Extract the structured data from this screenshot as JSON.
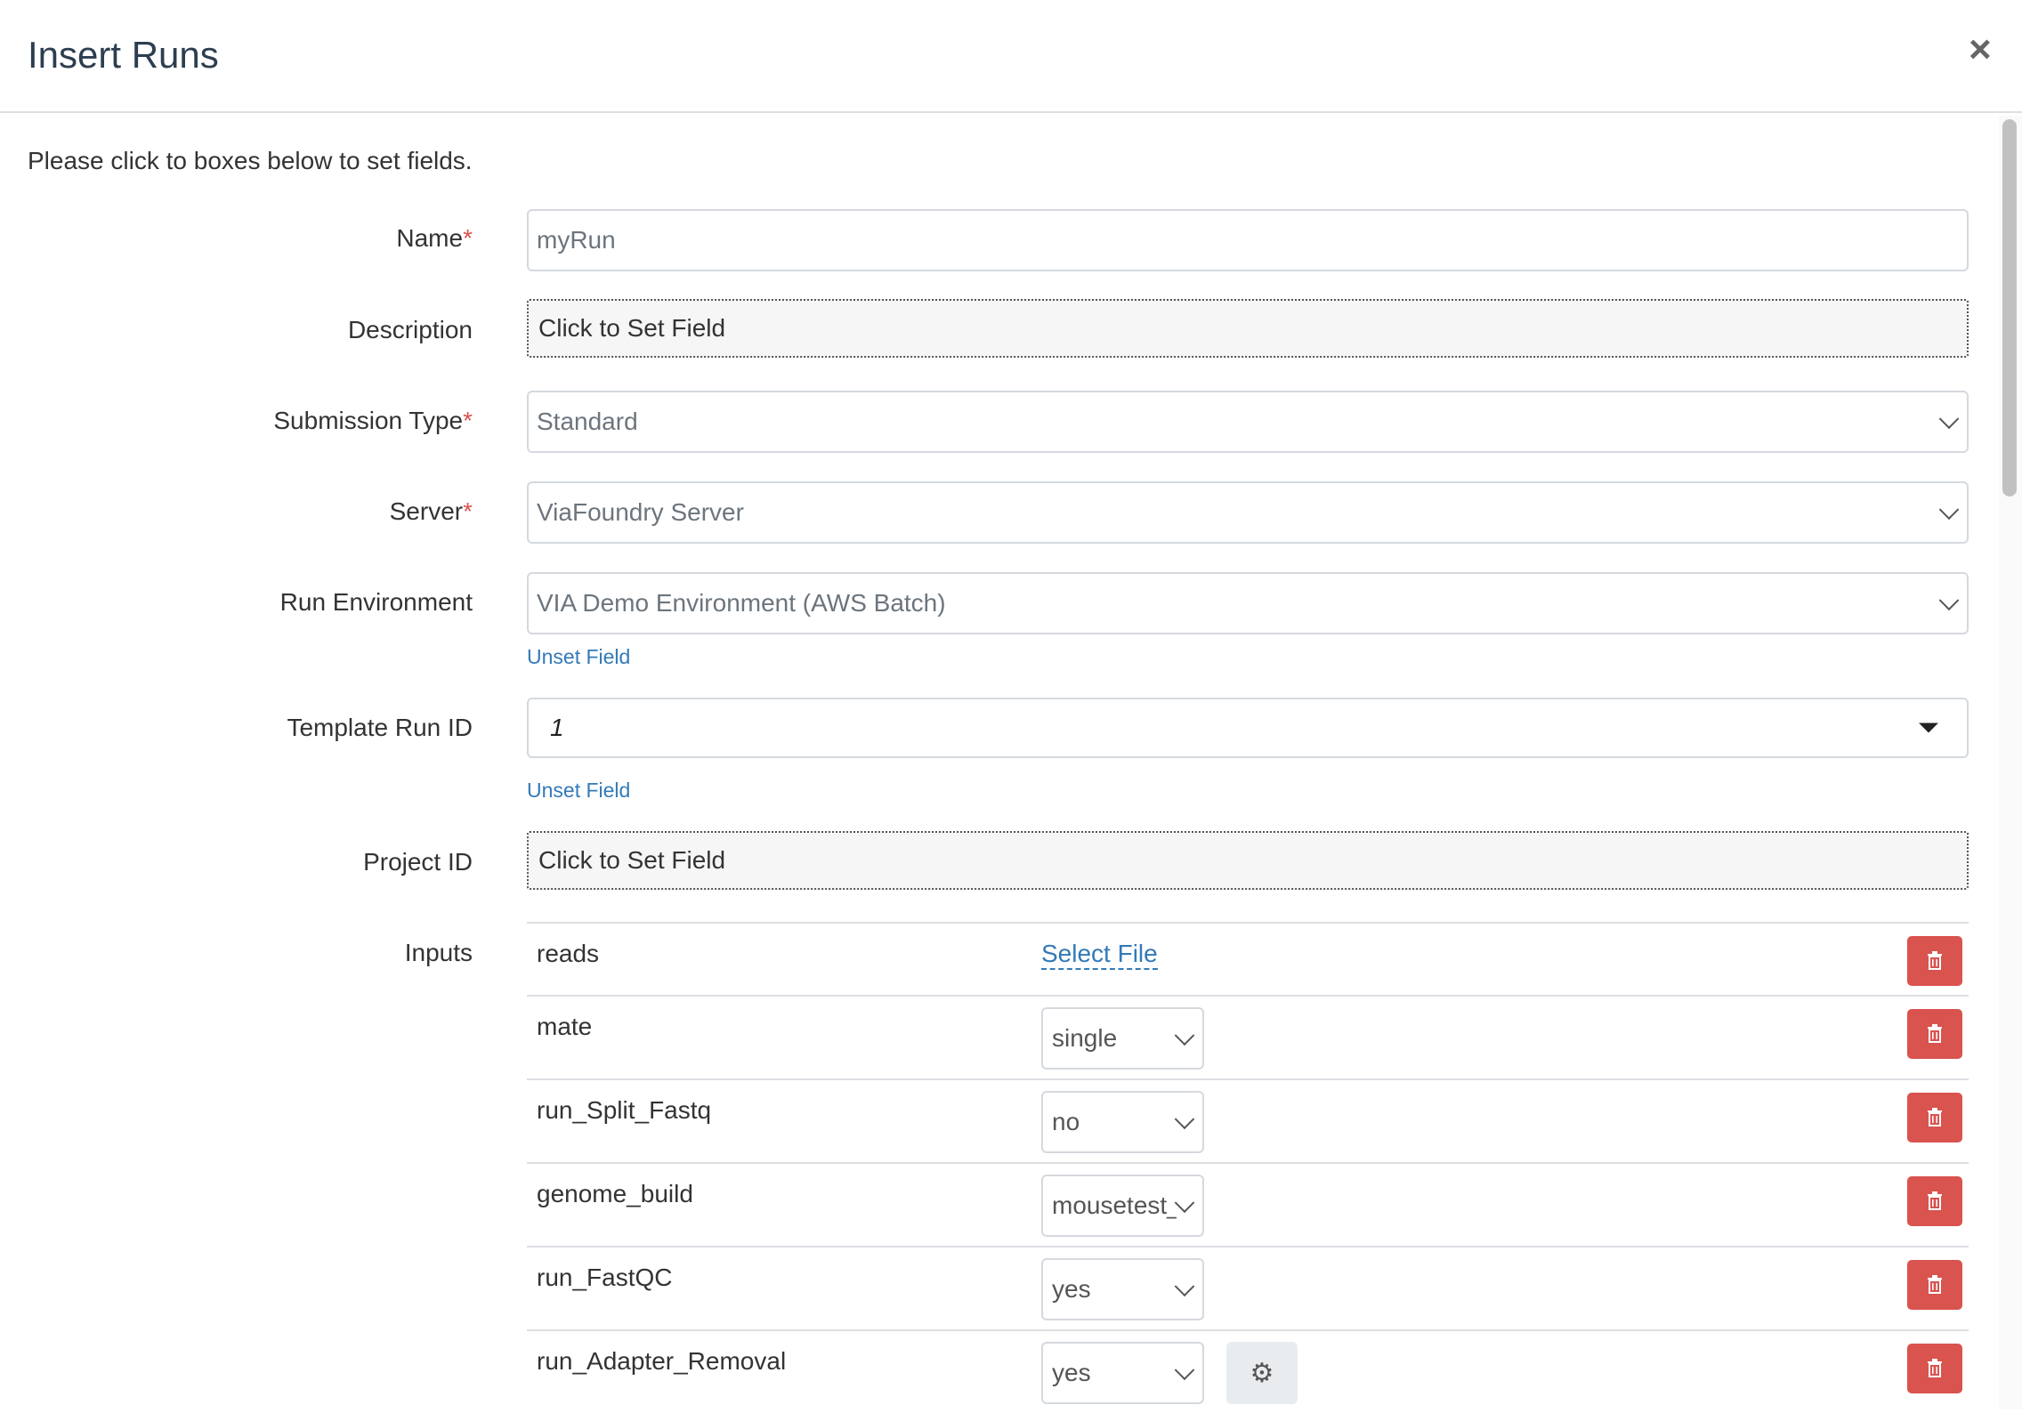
{
  "modal": {
    "title": "Insert Runs",
    "close_icon": "close-icon",
    "intro": "Please click to boxes below to set fields."
  },
  "form": {
    "name": {
      "label": "Name",
      "required": "*",
      "placeholder": "myRun"
    },
    "description": {
      "label": "Description",
      "value": "Click to Set Field"
    },
    "submission_type": {
      "label": "Submission Type",
      "required": "*",
      "value": "Standard"
    },
    "server": {
      "label": "Server",
      "required": "*",
      "value": "ViaFoundry Server"
    },
    "run_environment": {
      "label": "Run Environment",
      "value": "VIA Demo Environment (AWS Batch)",
      "unset": "Unset Field"
    },
    "template_run_id": {
      "label": "Template Run ID",
      "value": "1",
      "unset": "Unset Field"
    },
    "project_id": {
      "label": "Project ID",
      "value": "Click to Set Field"
    },
    "inputs": {
      "label": "Inputs",
      "rows": [
        {
          "name": "reads",
          "action": "Select File"
        },
        {
          "name": "mate",
          "value": "single"
        },
        {
          "name": "run_Split_Fastq",
          "value": "no"
        },
        {
          "name": "genome_build",
          "value": "mousetest_"
        },
        {
          "name": "run_FastQC",
          "value": "yes"
        },
        {
          "name": "run_Adapter_Removal",
          "value": "yes"
        }
      ]
    }
  },
  "colors": {
    "accent": "#337ab7",
    "danger": "#d9534f",
    "required": "#d9534f"
  }
}
